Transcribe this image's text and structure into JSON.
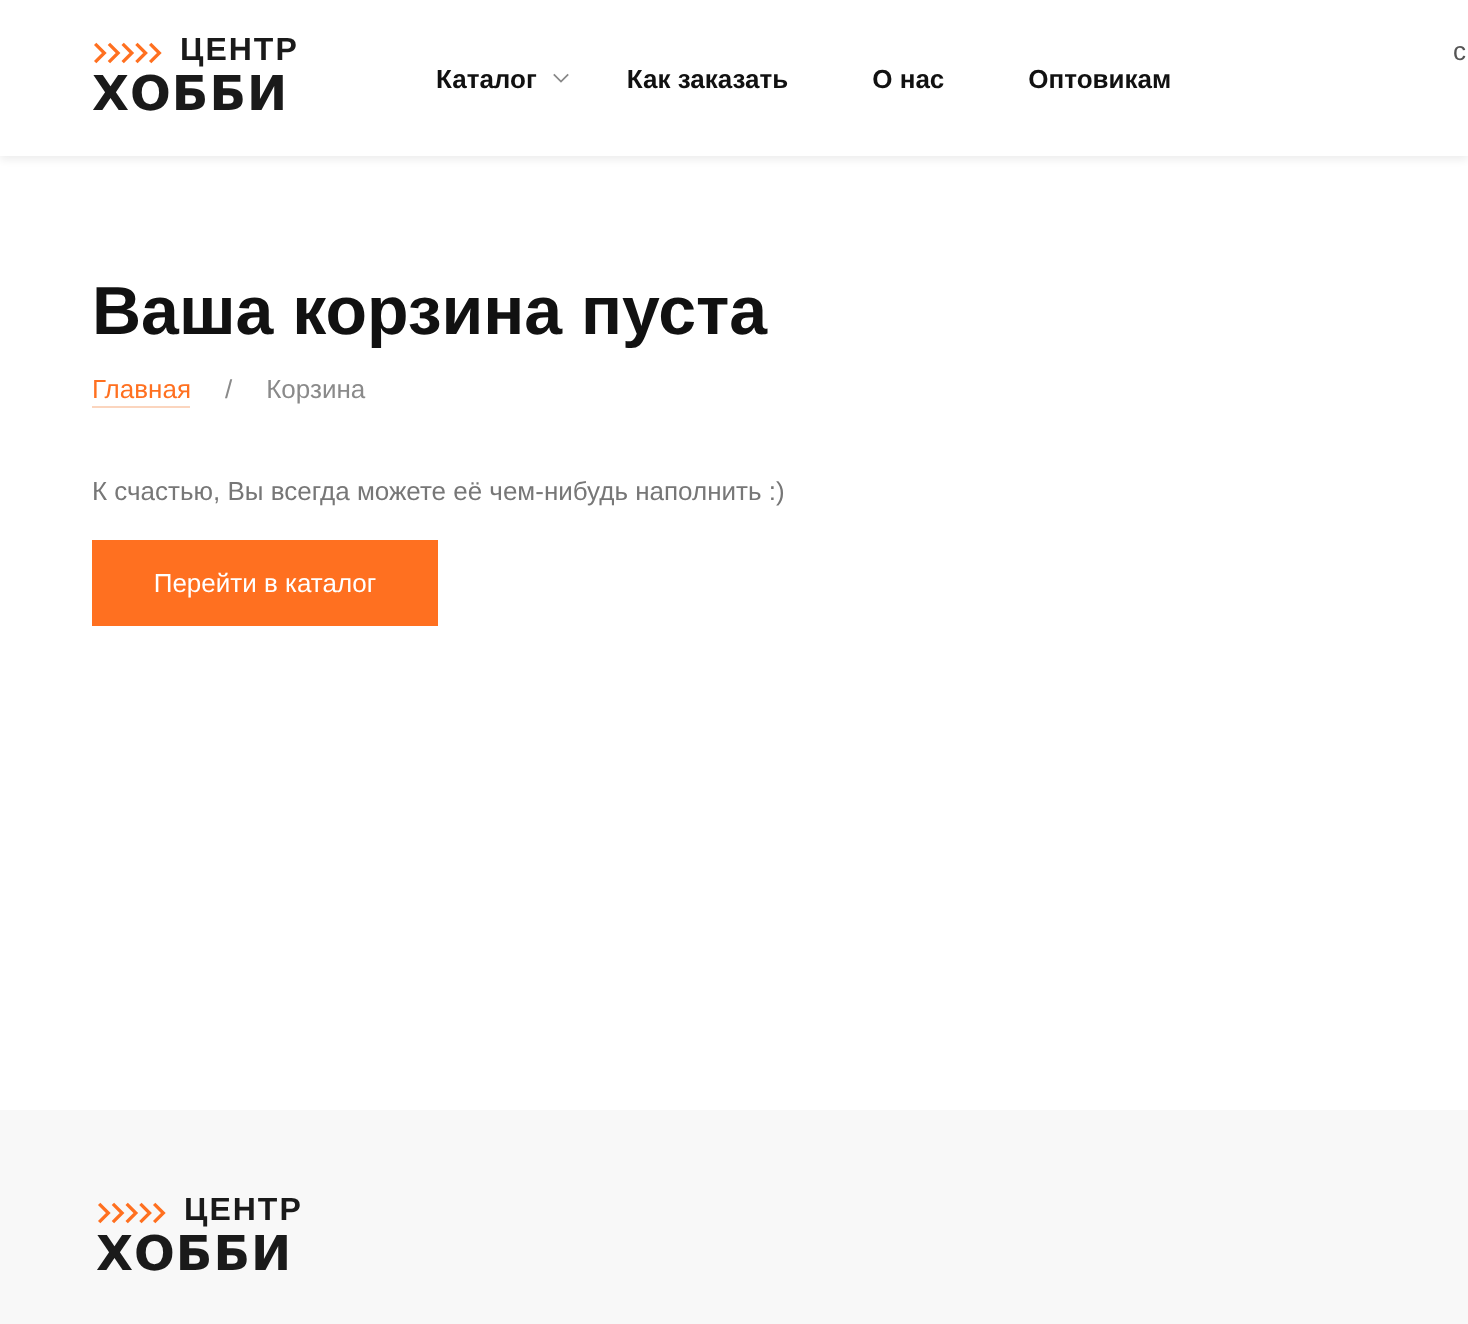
{
  "header": {
    "logo": {
      "top": "ЦЕНТР",
      "bottom": "ХОББИ"
    },
    "nav": [
      {
        "label": "Каталог",
        "kind": "dropdown"
      },
      {
        "label": "Как заказать",
        "kind": "link"
      },
      {
        "label": "О нас",
        "kind": "link"
      },
      {
        "label": "Оптовикам",
        "kind": "link"
      }
    ],
    "edge_text": "с"
  },
  "title": "Ваша корзина пуста",
  "breadcrumbs": [
    {
      "label": "Главная",
      "kind": "link"
    },
    {
      "label": "/",
      "kind": "separator"
    },
    {
      "label": "Корзина",
      "kind": "current"
    }
  ],
  "message": "К счастью, Вы всегда можете её чем-нибудь наполнить :)",
  "button": "Перейти в каталог",
  "footer": {
    "logo": {
      "top": "ЦЕНТР",
      "bottom": "ХОББИ"
    }
  }
}
